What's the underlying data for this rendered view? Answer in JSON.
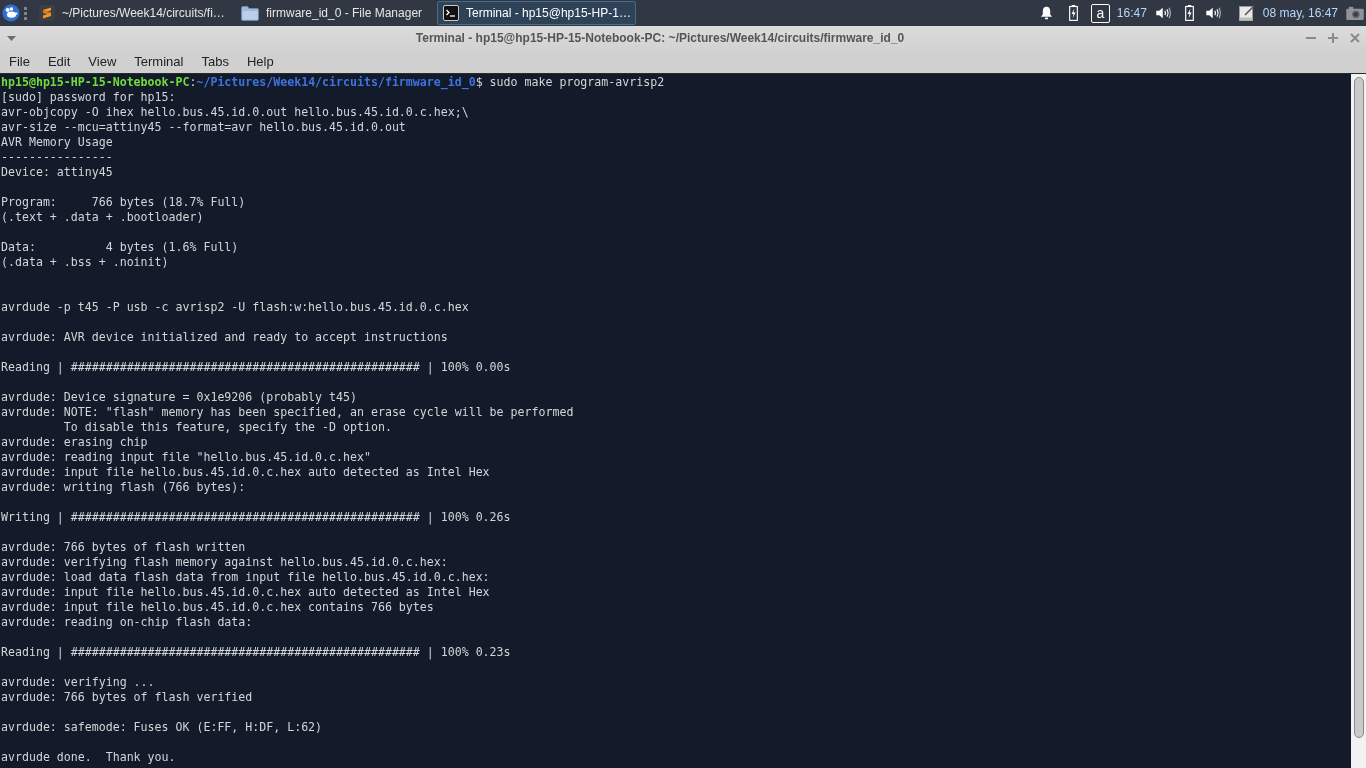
{
  "taskbar": {
    "tasks": [
      {
        "kind": "editor",
        "label": "~/Pictures/Week14/circuits/fi…",
        "selected": false
      },
      {
        "kind": "file-manager",
        "label": "firmware_id_0 - File Manager",
        "selected": false
      },
      {
        "kind": "terminal",
        "label": "Terminal - hp15@hp15-HP-1…",
        "selected": true
      }
    ],
    "tray": {
      "keyboard_layout": "a",
      "clock": "16:47",
      "date_time": "08 may, 16:47"
    }
  },
  "window": {
    "title": "Terminal - hp15@hp15-HP-15-Notebook-PC: ~/Pictures/Week14/circuits/firmware_id_0",
    "menu": [
      "File",
      "Edit",
      "View",
      "Terminal",
      "Tabs",
      "Help"
    ]
  },
  "terminal": {
    "lines": [
      {
        "kind": "prompt",
        "segments": [
          {
            "kind": "user",
            "text": "hp15@hp15-HP-15-Notebook-PC"
          },
          {
            "kind": "plain",
            "text": ":"
          },
          {
            "kind": "path",
            "text": "~/Pictures/Week14/circuits/firmware_id_0"
          },
          {
            "kind": "plain",
            "text": "$ sudo make program-avrisp2"
          }
        ]
      },
      {
        "kind": "output",
        "text": "[sudo] password for hp15:"
      },
      {
        "kind": "output",
        "text": "avr-objcopy -O ihex hello.bus.45.id.0.out hello.bus.45.id.0.c.hex;\\"
      },
      {
        "kind": "output",
        "text": "avr-size --mcu=attiny45 --format=avr hello.bus.45.id.0.out"
      },
      {
        "kind": "output",
        "text": "AVR Memory Usage"
      },
      {
        "kind": "output",
        "text": "----------------"
      },
      {
        "kind": "output",
        "text": "Device: attiny45"
      },
      {
        "kind": "blank"
      },
      {
        "kind": "output",
        "text": "Program:     766 bytes (18.7% Full)"
      },
      {
        "kind": "output",
        "text": "(.text + .data + .bootloader)"
      },
      {
        "kind": "blank"
      },
      {
        "kind": "output",
        "text": "Data:          4 bytes (1.6% Full)"
      },
      {
        "kind": "output",
        "text": "(.data + .bss + .noinit)"
      },
      {
        "kind": "blank"
      },
      {
        "kind": "blank"
      },
      {
        "kind": "output",
        "text": "avrdude -p t45 -P usb -c avrisp2 -U flash:w:hello.bus.45.id.0.c.hex"
      },
      {
        "kind": "blank"
      },
      {
        "kind": "output",
        "text": "avrdude: AVR device initialized and ready to accept instructions"
      },
      {
        "kind": "blank"
      },
      {
        "kind": "output",
        "text": "Reading | ################################################## | 100% 0.00s"
      },
      {
        "kind": "blank"
      },
      {
        "kind": "output",
        "text": "avrdude: Device signature = 0x1e9206 (probably t45)"
      },
      {
        "kind": "output",
        "text": "avrdude: NOTE: \"flash\" memory has been specified, an erase cycle will be performed"
      },
      {
        "kind": "output",
        "text": "         To disable this feature, specify the -D option."
      },
      {
        "kind": "output",
        "text": "avrdude: erasing chip"
      },
      {
        "kind": "output",
        "text": "avrdude: reading input file \"hello.bus.45.id.0.c.hex\""
      },
      {
        "kind": "output",
        "text": "avrdude: input file hello.bus.45.id.0.c.hex auto detected as Intel Hex"
      },
      {
        "kind": "output",
        "text": "avrdude: writing flash (766 bytes):"
      },
      {
        "kind": "blank"
      },
      {
        "kind": "output",
        "text": "Writing | ################################################## | 100% 0.26s"
      },
      {
        "kind": "blank"
      },
      {
        "kind": "output",
        "text": "avrdude: 766 bytes of flash written"
      },
      {
        "kind": "output",
        "text": "avrdude: verifying flash memory against hello.bus.45.id.0.c.hex:"
      },
      {
        "kind": "output",
        "text": "avrdude: load data flash data from input file hello.bus.45.id.0.c.hex:"
      },
      {
        "kind": "output",
        "text": "avrdude: input file hello.bus.45.id.0.c.hex auto detected as Intel Hex"
      },
      {
        "kind": "output",
        "text": "avrdude: input file hello.bus.45.id.0.c.hex contains 766 bytes"
      },
      {
        "kind": "output",
        "text": "avrdude: reading on-chip flash data:"
      },
      {
        "kind": "blank"
      },
      {
        "kind": "output",
        "text": "Reading | ################################################## | 100% 0.23s"
      },
      {
        "kind": "blank"
      },
      {
        "kind": "output",
        "text": "avrdude: verifying ..."
      },
      {
        "kind": "output",
        "text": "avrdude: 766 bytes of flash verified"
      },
      {
        "kind": "blank"
      },
      {
        "kind": "output",
        "text": "avrdude: safemode: Fuses OK (E:FF, H:DF, L:62)"
      },
      {
        "kind": "blank"
      },
      {
        "kind": "output",
        "text": "avrdude done.  Thank you."
      }
    ]
  }
}
